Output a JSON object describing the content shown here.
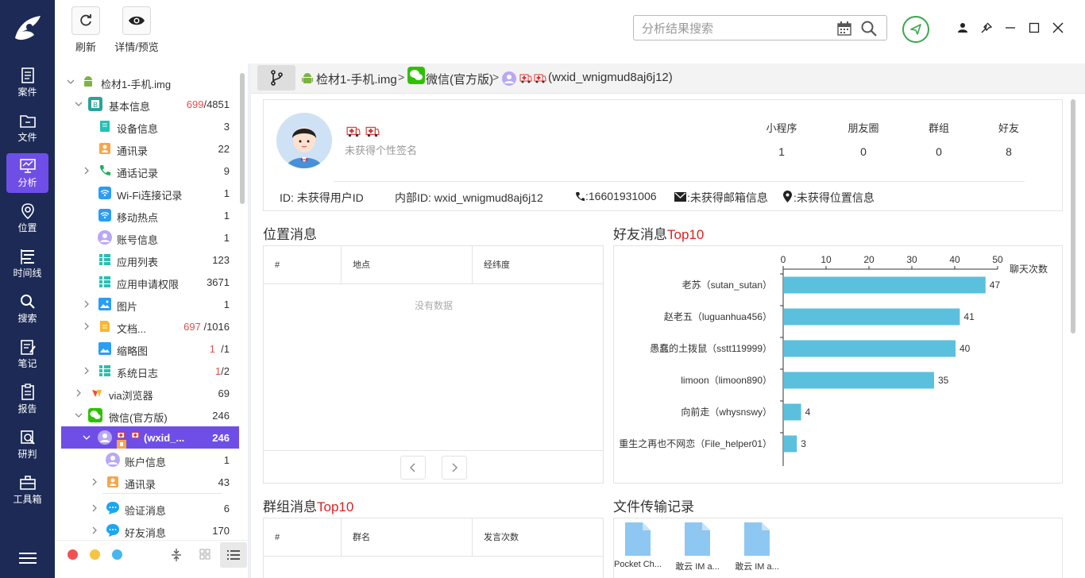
{
  "nav": [
    {
      "label": "案件",
      "icon": "case-icon"
    },
    {
      "label": "文件",
      "icon": "folder-icon"
    },
    {
      "label": "分析",
      "icon": "analysis-icon",
      "active": true
    },
    {
      "label": "位置",
      "icon": "location-icon"
    },
    {
      "label": "时间线",
      "icon": "timeline-icon"
    },
    {
      "label": "搜索",
      "icon": "search-icon"
    },
    {
      "label": "笔记",
      "icon": "note-icon"
    },
    {
      "label": "报告",
      "icon": "report-icon"
    },
    {
      "label": "研判",
      "icon": "judge-icon"
    },
    {
      "label": "工具箱",
      "icon": "toolbox-icon"
    }
  ],
  "toolbar": {
    "refresh": "刷新",
    "detail": "详情/预览"
  },
  "search": {
    "placeholder": "分析结果搜索"
  },
  "tree": {
    "root": "检材1-手机.img",
    "basic": {
      "label": "基本信息",
      "count_red": "699",
      "count_total": "/4851"
    },
    "items": [
      {
        "label": "设备信息",
        "count": "3"
      },
      {
        "label": "通讯录",
        "count": "22"
      },
      {
        "label": "通话记录",
        "count": "9"
      },
      {
        "label": "Wi-Fi连接记录",
        "count": "1"
      },
      {
        "label": "移动热点",
        "count": "1"
      },
      {
        "label": "账号信息",
        "count": "1"
      },
      {
        "label": "应用列表",
        "count": "123"
      },
      {
        "label": "应用申请权限",
        "count": "3671"
      },
      {
        "label": "图片",
        "count": "1"
      }
    ],
    "docs": {
      "label": "文档...",
      "count_red": "697",
      "count_total": "/1016"
    },
    "thumbs": {
      "label": "缩略图",
      "count_red": "1",
      "count_total": "/1"
    },
    "syslog": {
      "label": "系统日志",
      "count_red": "1",
      "count_total": "/2"
    },
    "via": {
      "label": "via浏览器",
      "count": "69"
    },
    "wechat": {
      "label": "微信(官方版)",
      "count": "246"
    },
    "selected": {
      "label": "(wxid_...",
      "count": "246"
    },
    "account": {
      "label": "账户信息",
      "count": "1"
    },
    "contacts": {
      "label": "通讯录",
      "count": "43"
    },
    "verify": {
      "label": "验证消息",
      "count": "6"
    },
    "friendmsg": {
      "label": "好友消息",
      "count": "170"
    }
  },
  "breadcrumb": {
    "c1": "检材1-手机.img",
    "c2": "微信(官方版)",
    "c3": "(wxid_wnigmud8aj6j12)",
    "sep": ">"
  },
  "profile": {
    "signature": "未获得个性签名",
    "stats": [
      {
        "label": "小程序",
        "value": "1"
      },
      {
        "label": "朋友圈",
        "value": "0"
      },
      {
        "label": "群组",
        "value": "0"
      },
      {
        "label": "好友",
        "value": "8"
      }
    ],
    "id": "ID: 未获得用户ID",
    "inner_id": "内部ID: wxid_wnigmud8aj6j12",
    "phone": ":16601931006",
    "email": ":未获得邮箱信息",
    "location": ":未获得位置信息"
  },
  "location_section": {
    "title": "位置消息",
    "columns": [
      "#",
      "地点",
      "经纬度"
    ],
    "empty": "没有数据"
  },
  "friends_section": {
    "title": "好友消息",
    "title_hl": "Top10"
  },
  "group_section": {
    "title": "群组消息",
    "title_hl": "Top10",
    "columns": [
      "#",
      "群名",
      "发言次数"
    ]
  },
  "files_section": {
    "title": "文件传输记录",
    "files": [
      "Pocket Ch...",
      "敢云 IM a...",
      "敢云 IM a..."
    ]
  },
  "chart_data": {
    "type": "bar",
    "orientation": "horizontal",
    "categories": [
      "老苏（sutan_sutan）",
      "赵老五（luguanhua456）",
      "愚蠢的土拨鼠（sstt119999）",
      "limoon（limoon890）",
      "向前走（whysnswy）",
      "重生之再也不网恋（File_helper01）"
    ],
    "values": [
      47,
      41,
      40,
      35,
      4,
      3
    ],
    "xlabel": "聊天次数",
    "xlim": [
      0,
      50
    ],
    "xticks": [
      0,
      10,
      20,
      30,
      40,
      50
    ],
    "color": "#5bc0de",
    "axis_position": "top"
  }
}
